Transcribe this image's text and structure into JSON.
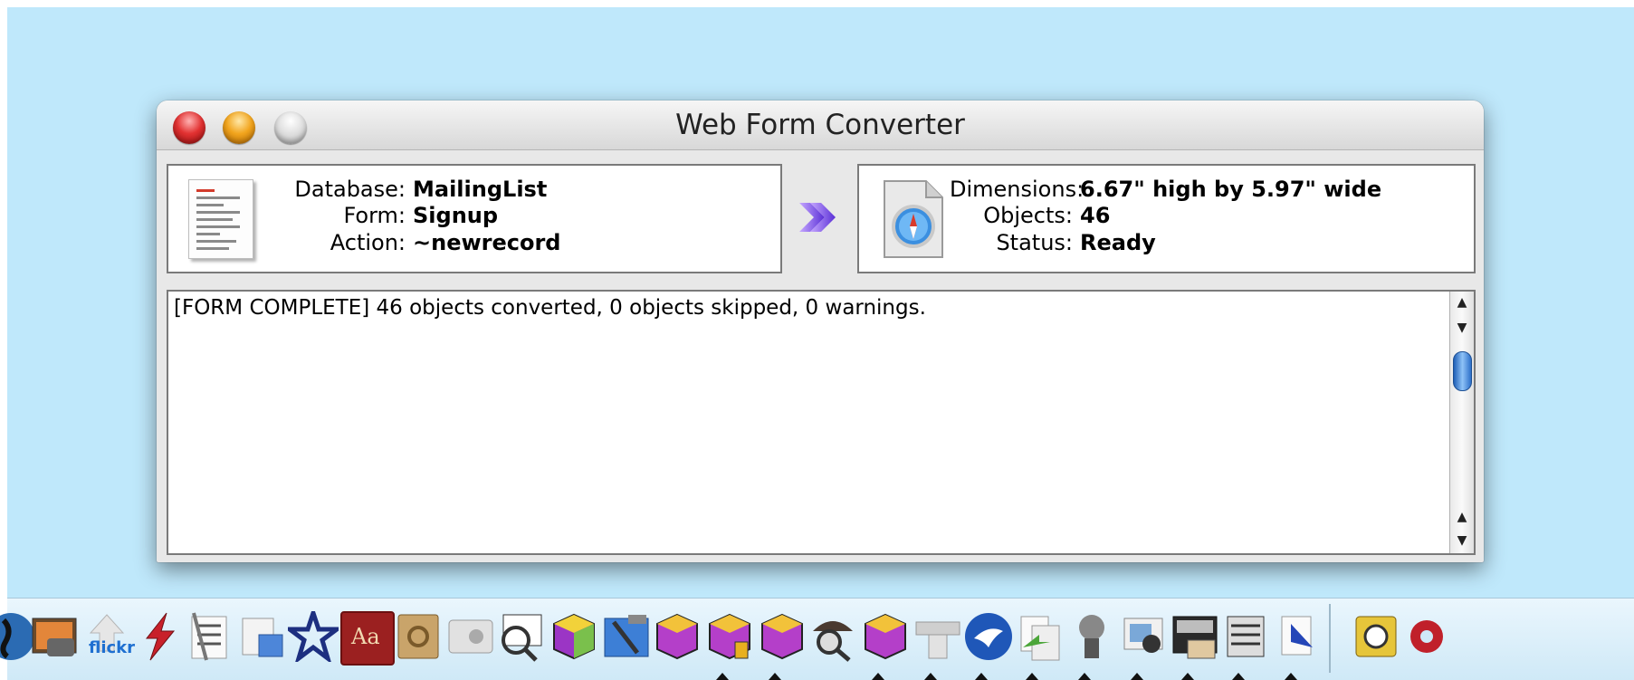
{
  "window": {
    "title": "Web Form Converter"
  },
  "source": {
    "rows": [
      {
        "label": "Database:",
        "value": "MailingList"
      },
      {
        "label": "Form:",
        "value": "Signup"
      },
      {
        "label": "Action:",
        "value": "~newrecord"
      }
    ]
  },
  "target": {
    "rows": [
      {
        "label": "Dimensions:",
        "value": "6.67\" high by 5.97\" wide"
      },
      {
        "label": "Objects:",
        "value": "46"
      },
      {
        "label": "Status:",
        "value": "Ready"
      }
    ]
  },
  "log": {
    "text": "[FORM COMPLETE] 46 objects converted, 0 objects skipped, 0 warnings."
  },
  "dock": {
    "flickr_label": "flickr",
    "dictionary_label": "Aa"
  },
  "colors": {
    "desktop": "#bfe8fb",
    "arrow": "#7b4de8"
  }
}
